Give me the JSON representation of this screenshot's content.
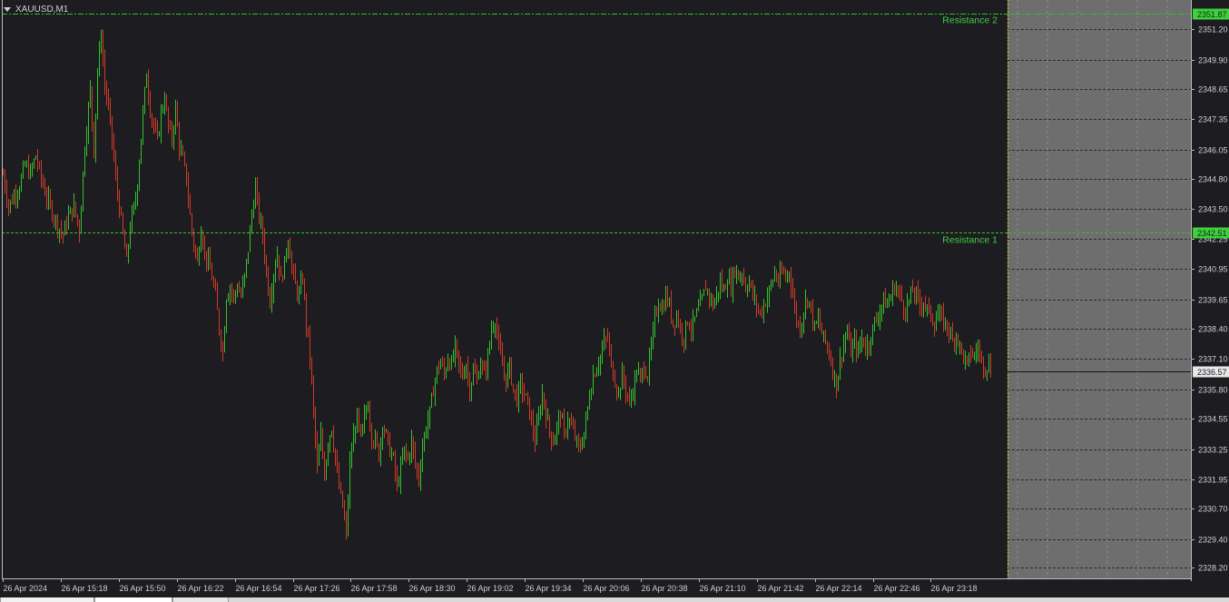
{
  "window": {
    "symbol_title": "XAUUSD,M1"
  },
  "price_axis": {
    "ticks": [
      "2351.20",
      "2349.90",
      "2348.65",
      "2347.35",
      "2346.05",
      "2344.80",
      "2343.50",
      "2342.25",
      "2340.95",
      "2339.65",
      "2338.40",
      "2337.10",
      "2335.80",
      "2334.55",
      "2333.25",
      "2331.95",
      "2330.70",
      "2329.40",
      "2328.20"
    ]
  },
  "time_axis": {
    "ticks": [
      "26 Apr 2024",
      "26 Apr 15:18",
      "26 Apr 15:50",
      "26 Apr 16:22",
      "26 Apr 16:54",
      "26 Apr 17:26",
      "26 Apr 17:58",
      "26 Apr 18:30",
      "26 Apr 19:02",
      "26 Apr 19:34",
      "26 Apr 20:06",
      "26 Apr 20:38",
      "26 Apr 21:10",
      "26 Apr 21:42",
      "26 Apr 22:14",
      "26 Apr 22:46",
      "26 Apr 23:18"
    ]
  },
  "levels": {
    "resistance2": {
      "label": "Resistance 2",
      "price": "2351.87",
      "color": "#3fcf3f"
    },
    "resistance1": {
      "label": "Resistance 1",
      "price": "2342.51",
      "color": "#3fcf3f"
    },
    "current": {
      "price": "2336.57"
    }
  },
  "colors": {
    "background": "#1c1c21",
    "bull": "#34c22b",
    "bear": "#d23a27",
    "grid": "#8a8a8a",
    "future_zone": "#6e6e6e",
    "separator": "#e0d000"
  },
  "chart_data": {
    "type": "bar",
    "symbol": "XAUUSD",
    "timeframe": "M1",
    "ylim": [
      2327.9,
      2352.6
    ],
    "y_ticks": [
      2351.2,
      2349.9,
      2348.65,
      2347.35,
      2346.05,
      2344.8,
      2343.5,
      2342.25,
      2340.95,
      2339.65,
      2338.4,
      2337.1,
      2335.8,
      2334.55,
      2333.25,
      2331.95,
      2330.7,
      2329.4,
      2328.2
    ],
    "x_ticks": [
      "26 Apr 2024",
      "26 Apr 15:18",
      "26 Apr 15:50",
      "26 Apr 16:22",
      "26 Apr 16:54",
      "26 Apr 17:26",
      "26 Apr 17:58",
      "26 Apr 18:30",
      "26 Apr 19:02",
      "26 Apr 19:34",
      "26 Apr 20:06",
      "26 Apr 20:38",
      "26 Apr 21:10",
      "26 Apr 21:42",
      "26 Apr 22:14",
      "26 Apr 22:46",
      "26 Apr 23:18"
    ],
    "horizontal_lines": [
      {
        "name": "Resistance 2",
        "value": 2351.87
      },
      {
        "name": "Resistance 1",
        "value": 2342.51
      },
      {
        "name": "",
        "value": 2336.57
      }
    ],
    "path": [
      [
        0,
        2345.0
      ],
      [
        6,
        2343.6
      ],
      [
        12,
        2344.1
      ],
      [
        18,
        2344.5
      ],
      [
        24,
        2345.4
      ],
      [
        30,
        2345.0
      ],
      [
        36,
        2345.8
      ],
      [
        42,
        2344.8
      ],
      [
        48,
        2344.0
      ],
      [
        54,
        2343.4
      ],
      [
        60,
        2342.8
      ],
      [
        66,
        2342.4
      ],
      [
        72,
        2343.2
      ],
      [
        78,
        2343.6
      ],
      [
        84,
        2342.6
      ],
      [
        90,
        2346.2
      ],
      [
        96,
        2348.6
      ],
      [
        100,
        2346.0
      ],
      [
        104,
        2349.4
      ],
      [
        108,
        2351.0
      ],
      [
        112,
        2348.8
      ],
      [
        116,
        2347.8
      ],
      [
        120,
        2346.5
      ],
      [
        124,
        2344.8
      ],
      [
        128,
        2343.6
      ],
      [
        132,
        2342.4
      ],
      [
        136,
        2341.2
      ],
      [
        140,
        2342.8
      ],
      [
        146,
        2343.9
      ],
      [
        150,
        2345.6
      ],
      [
        154,
        2347.6
      ],
      [
        158,
        2349.3
      ],
      [
        162,
        2347.8
      ],
      [
        166,
        2347.0
      ],
      [
        170,
        2346.4
      ],
      [
        174,
        2347.6
      ],
      [
        178,
        2348.3
      ],
      [
        182,
        2347.0
      ],
      [
        186,
        2346.5
      ],
      [
        190,
        2347.8
      ],
      [
        194,
        2346.2
      ],
      [
        198,
        2345.6
      ],
      [
        202,
        2344.8
      ],
      [
        206,
        2343.2
      ],
      [
        210,
        2342.0
      ],
      [
        214,
        2341.2
      ],
      [
        218,
        2342.8
      ],
      [
        222,
        2341.6
      ],
      [
        226,
        2341.2
      ],
      [
        230,
        2340.6
      ],
      [
        234,
        2339.8
      ],
      [
        238,
        2338.4
      ],
      [
        242,
        2337.4
      ],
      [
        246,
        2339.8
      ],
      [
        250,
        2340.2
      ],
      [
        254,
        2339.7
      ],
      [
        258,
        2340.2
      ],
      [
        262,
        2339.8
      ],
      [
        266,
        2340.6
      ],
      [
        270,
        2341.8
      ],
      [
        274,
        2343.3
      ],
      [
        278,
        2344.4
      ],
      [
        282,
        2343.2
      ],
      [
        286,
        2342.4
      ],
      [
        290,
        2340.8
      ],
      [
        294,
        2339.6
      ],
      [
        298,
        2340.8
      ],
      [
        302,
        2341.6
      ],
      [
        306,
        2340.4
      ],
      [
        310,
        2341.2
      ],
      [
        314,
        2342.3
      ],
      [
        318,
        2341.0
      ],
      [
        322,
        2340.2
      ],
      [
        326,
        2339.8
      ],
      [
        330,
        2340.6
      ],
      [
        334,
        2338.6
      ],
      [
        338,
        2337.2
      ],
      [
        342,
        2334.8
      ],
      [
        346,
        2332.4
      ],
      [
        350,
        2333.8
      ],
      [
        354,
        2332.2
      ],
      [
        358,
        2333.6
      ],
      [
        362,
        2334.2
      ],
      [
        366,
        2332.8
      ],
      [
        370,
        2331.6
      ],
      [
        374,
        2330.8
      ],
      [
        378,
        2329.6
      ],
      [
        382,
        2332.6
      ],
      [
        386,
        2333.8
      ],
      [
        390,
        2334.6
      ],
      [
        394,
        2333.6
      ],
      [
        398,
        2334.6
      ],
      [
        402,
        2335.2
      ],
      [
        406,
        2333.8
      ],
      [
        410,
        2333.6
      ],
      [
        414,
        2333.0
      ],
      [
        418,
        2334.4
      ],
      [
        422,
        2333.8
      ],
      [
        426,
        2333.2
      ],
      [
        430,
        2332.8
      ],
      [
        434,
        2331.6
      ],
      [
        438,
        2332.4
      ],
      [
        442,
        2333.2
      ],
      [
        446,
        2332.8
      ],
      [
        450,
        2333.6
      ],
      [
        454,
        2332.6
      ],
      [
        458,
        2332.0
      ],
      [
        462,
        2333.4
      ],
      [
        466,
        2334.2
      ],
      [
        470,
        2334.8
      ],
      [
        474,
        2335.8
      ],
      [
        478,
        2336.6
      ],
      [
        482,
        2337.0
      ],
      [
        486,
        2336.4
      ],
      [
        490,
        2337.2
      ],
      [
        494,
        2336.8
      ],
      [
        498,
        2337.6
      ],
      [
        502,
        2336.8
      ],
      [
        506,
        2336.4
      ],
      [
        510,
        2336.9
      ],
      [
        514,
        2335.8
      ],
      [
        518,
        2336.6
      ],
      [
        522,
        2336.2
      ],
      [
        526,
        2337.0
      ],
      [
        530,
        2336.4
      ],
      [
        534,
        2337.2
      ],
      [
        538,
        2338.4
      ],
      [
        542,
        2338.8
      ],
      [
        546,
        2337.6
      ],
      [
        550,
        2336.8
      ],
      [
        554,
        2336.2
      ],
      [
        558,
        2336.8
      ],
      [
        562,
        2335.8
      ],
      [
        566,
        2335.4
      ],
      [
        570,
        2336.0
      ],
      [
        574,
        2335.6
      ],
      [
        578,
        2335.2
      ],
      [
        582,
        2334.4
      ],
      [
        586,
        2333.6
      ],
      [
        590,
        2334.6
      ],
      [
        594,
        2335.6
      ],
      [
        598,
        2334.8
      ],
      [
        602,
        2334.0
      ],
      [
        606,
        2333.6
      ],
      [
        610,
        2334.2
      ],
      [
        614,
        2334.8
      ],
      [
        618,
        2333.8
      ],
      [
        622,
        2334.6
      ],
      [
        626,
        2334.2
      ],
      [
        630,
        2333.8
      ],
      [
        634,
        2333.2
      ],
      [
        638,
        2333.6
      ],
      [
        642,
        2334.4
      ],
      [
        646,
        2335.6
      ],
      [
        650,
        2336.4
      ],
      [
        654,
        2336.8
      ],
      [
        658,
        2337.2
      ],
      [
        662,
        2337.8
      ],
      [
        666,
        2338.0
      ],
      [
        670,
        2336.8
      ],
      [
        674,
        2336.2
      ],
      [
        678,
        2335.6
      ],
      [
        682,
        2336.4
      ],
      [
        686,
        2335.8
      ],
      [
        690,
        2335.2
      ],
      [
        694,
        2335.8
      ],
      [
        698,
        2336.6
      ],
      [
        702,
        2336.2
      ],
      [
        706,
        2336.8
      ],
      [
        710,
        2336.4
      ],
      [
        714,
        2337.6
      ],
      [
        718,
        2338.8
      ],
      [
        722,
        2339.6
      ],
      [
        726,
        2339.2
      ],
      [
        730,
        2339.8
      ],
      [
        734,
        2339.4
      ],
      [
        738,
        2338.6
      ],
      [
        742,
        2339.0
      ],
      [
        746,
        2338.4
      ],
      [
        750,
        2338.0
      ],
      [
        754,
        2338.8
      ],
      [
        758,
        2338.4
      ],
      [
        762,
        2338.8
      ],
      [
        766,
        2339.2
      ],
      [
        770,
        2339.6
      ],
      [
        774,
        2340.2
      ],
      [
        778,
        2339.8
      ],
      [
        782,
        2339.4
      ],
      [
        786,
        2339.8
      ],
      [
        790,
        2340.4
      ],
      [
        794,
        2340.0
      ],
      [
        798,
        2340.6
      ],
      [
        802,
        2340.2
      ],
      [
        806,
        2341.0
      ],
      [
        810,
        2340.6
      ],
      [
        814,
        2340.8
      ],
      [
        818,
        2340.2
      ],
      [
        822,
        2340.4
      ],
      [
        826,
        2339.8
      ],
      [
        830,
        2339.4
      ],
      [
        834,
        2339.0
      ],
      [
        838,
        2339.4
      ],
      [
        842,
        2339.8
      ],
      [
        846,
        2340.2
      ],
      [
        850,
        2340.8
      ],
      [
        854,
        2340.4
      ],
      [
        858,
        2340.8
      ],
      [
        862,
        2340.6
      ],
      [
        866,
        2340.9
      ],
      [
        870,
        2339.8
      ],
      [
        874,
        2338.8
      ],
      [
        878,
        2338.4
      ],
      [
        882,
        2339.2
      ],
      [
        886,
        2339.8
      ],
      [
        890,
        2339.2
      ],
      [
        894,
        2338.4
      ],
      [
        898,
        2338.8
      ],
      [
        902,
        2338.2
      ],
      [
        906,
        2337.8
      ],
      [
        910,
        2337.4
      ],
      [
        914,
        2336.6
      ],
      [
        918,
        2336.0
      ],
      [
        922,
        2337.0
      ],
      [
        926,
        2337.8
      ],
      [
        930,
        2338.2
      ],
      [
        934,
        2337.4
      ],
      [
        938,
        2337.8
      ],
      [
        942,
        2337.4
      ],
      [
        946,
        2338.0
      ],
      [
        950,
        2337.6
      ],
      [
        954,
        2337.8
      ],
      [
        958,
        2338.4
      ],
      [
        962,
        2338.8
      ],
      [
        966,
        2339.2
      ],
      [
        970,
        2339.6
      ],
      [
        974,
        2339.4
      ],
      [
        978,
        2339.8
      ],
      [
        982,
        2340.2
      ],
      [
        986,
        2340.0
      ],
      [
        990,
        2339.6
      ],
      [
        994,
        2339.2
      ],
      [
        998,
        2339.6
      ],
      [
        1002,
        2340.0
      ],
      [
        1006,
        2339.8
      ],
      [
        1010,
        2339.4
      ],
      [
        1014,
        2339.6
      ],
      [
        1018,
        2339.2
      ],
      [
        1022,
        2339.0
      ],
      [
        1026,
        2338.6
      ],
      [
        1030,
        2339.0
      ],
      [
        1034,
        2338.8
      ],
      [
        1038,
        2338.6
      ],
      [
        1042,
        2338.4
      ],
      [
        1046,
        2337.8
      ],
      [
        1050,
        2338.2
      ],
      [
        1054,
        2337.6
      ],
      [
        1058,
        2337.2
      ],
      [
        1062,
        2336.8
      ],
      [
        1066,
        2337.4
      ],
      [
        1070,
        2337.2
      ],
      [
        1074,
        2337.6
      ],
      [
        1078,
        2337.0
      ],
      [
        1082,
        2336.8
      ],
      [
        1086,
        2336.9
      ],
      [
        1088,
        2336.57
      ]
    ]
  }
}
